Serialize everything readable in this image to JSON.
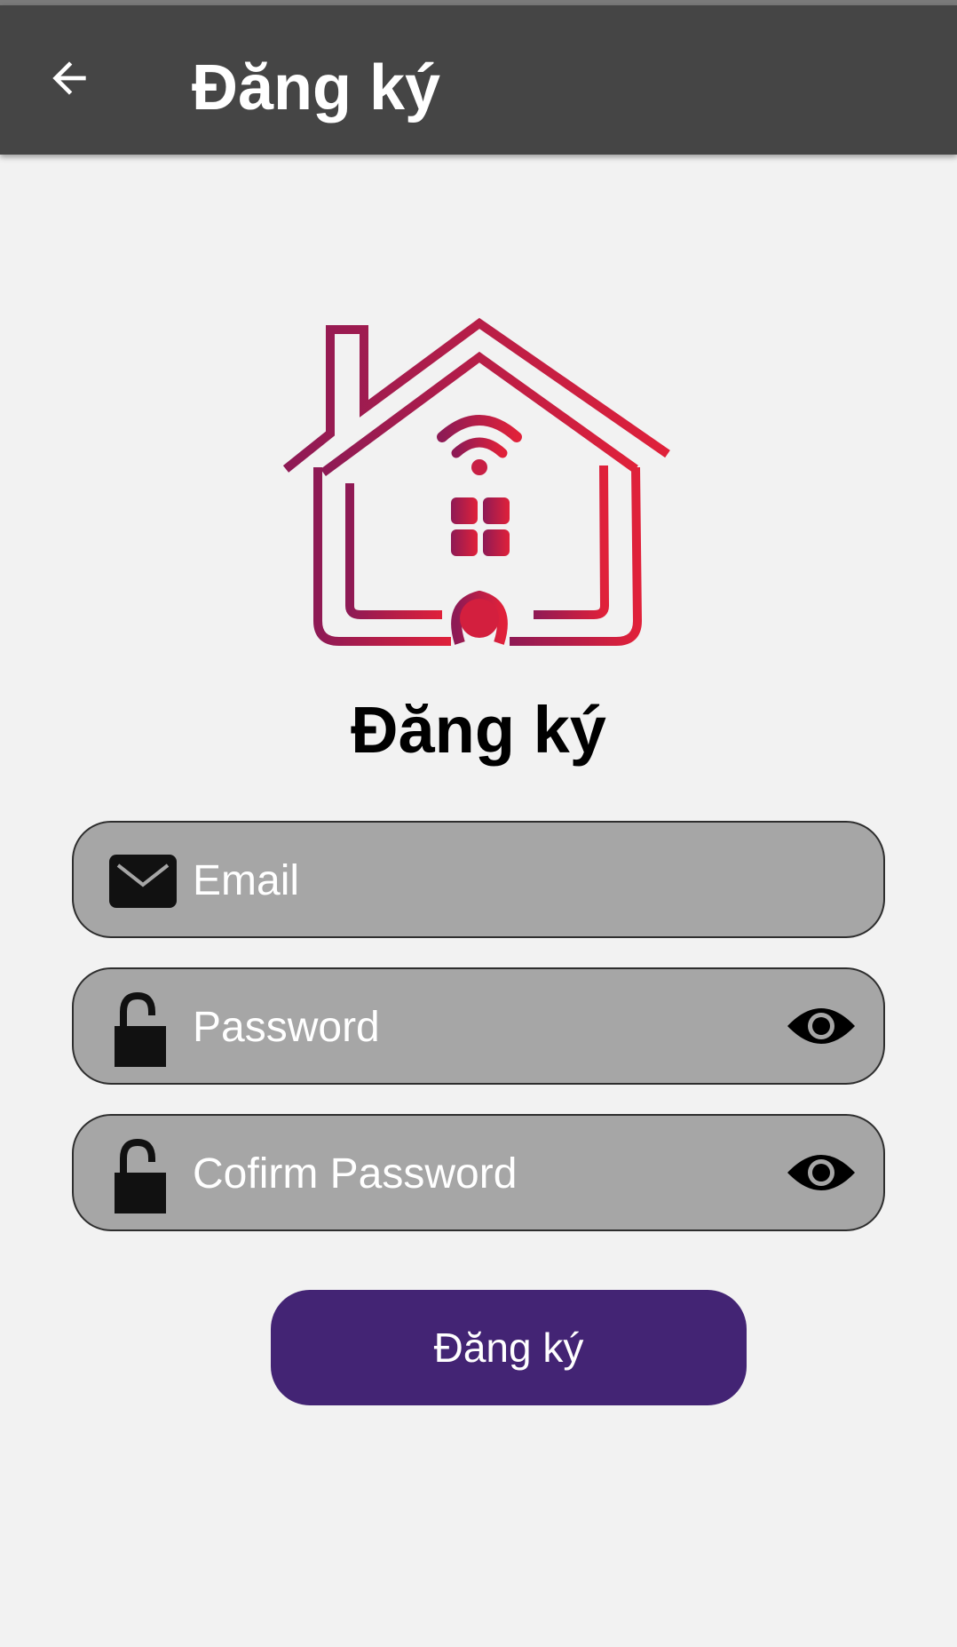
{
  "appbar": {
    "title": "Đăng ký",
    "back_icon": "arrow-left-icon",
    "background": "#454545"
  },
  "logo": {
    "icon": "smart-home-icon",
    "gradient": [
      "#8e1a55",
      "#e0213a"
    ]
  },
  "heading": "Đăng ký",
  "form": {
    "email": {
      "placeholder": "Email",
      "value": "",
      "icon": "mail-icon"
    },
    "password": {
      "placeholder": "Password",
      "value": "",
      "icon": "unlock-icon",
      "toggle_icon": "eye-icon"
    },
    "confirm_password": {
      "placeholder": "Cofirm Password",
      "value": "",
      "icon": "unlock-icon",
      "toggle_icon": "eye-icon"
    },
    "field_background": "#a6a6a6"
  },
  "submit": {
    "label": "Đăng ký",
    "color": "#432474"
  }
}
